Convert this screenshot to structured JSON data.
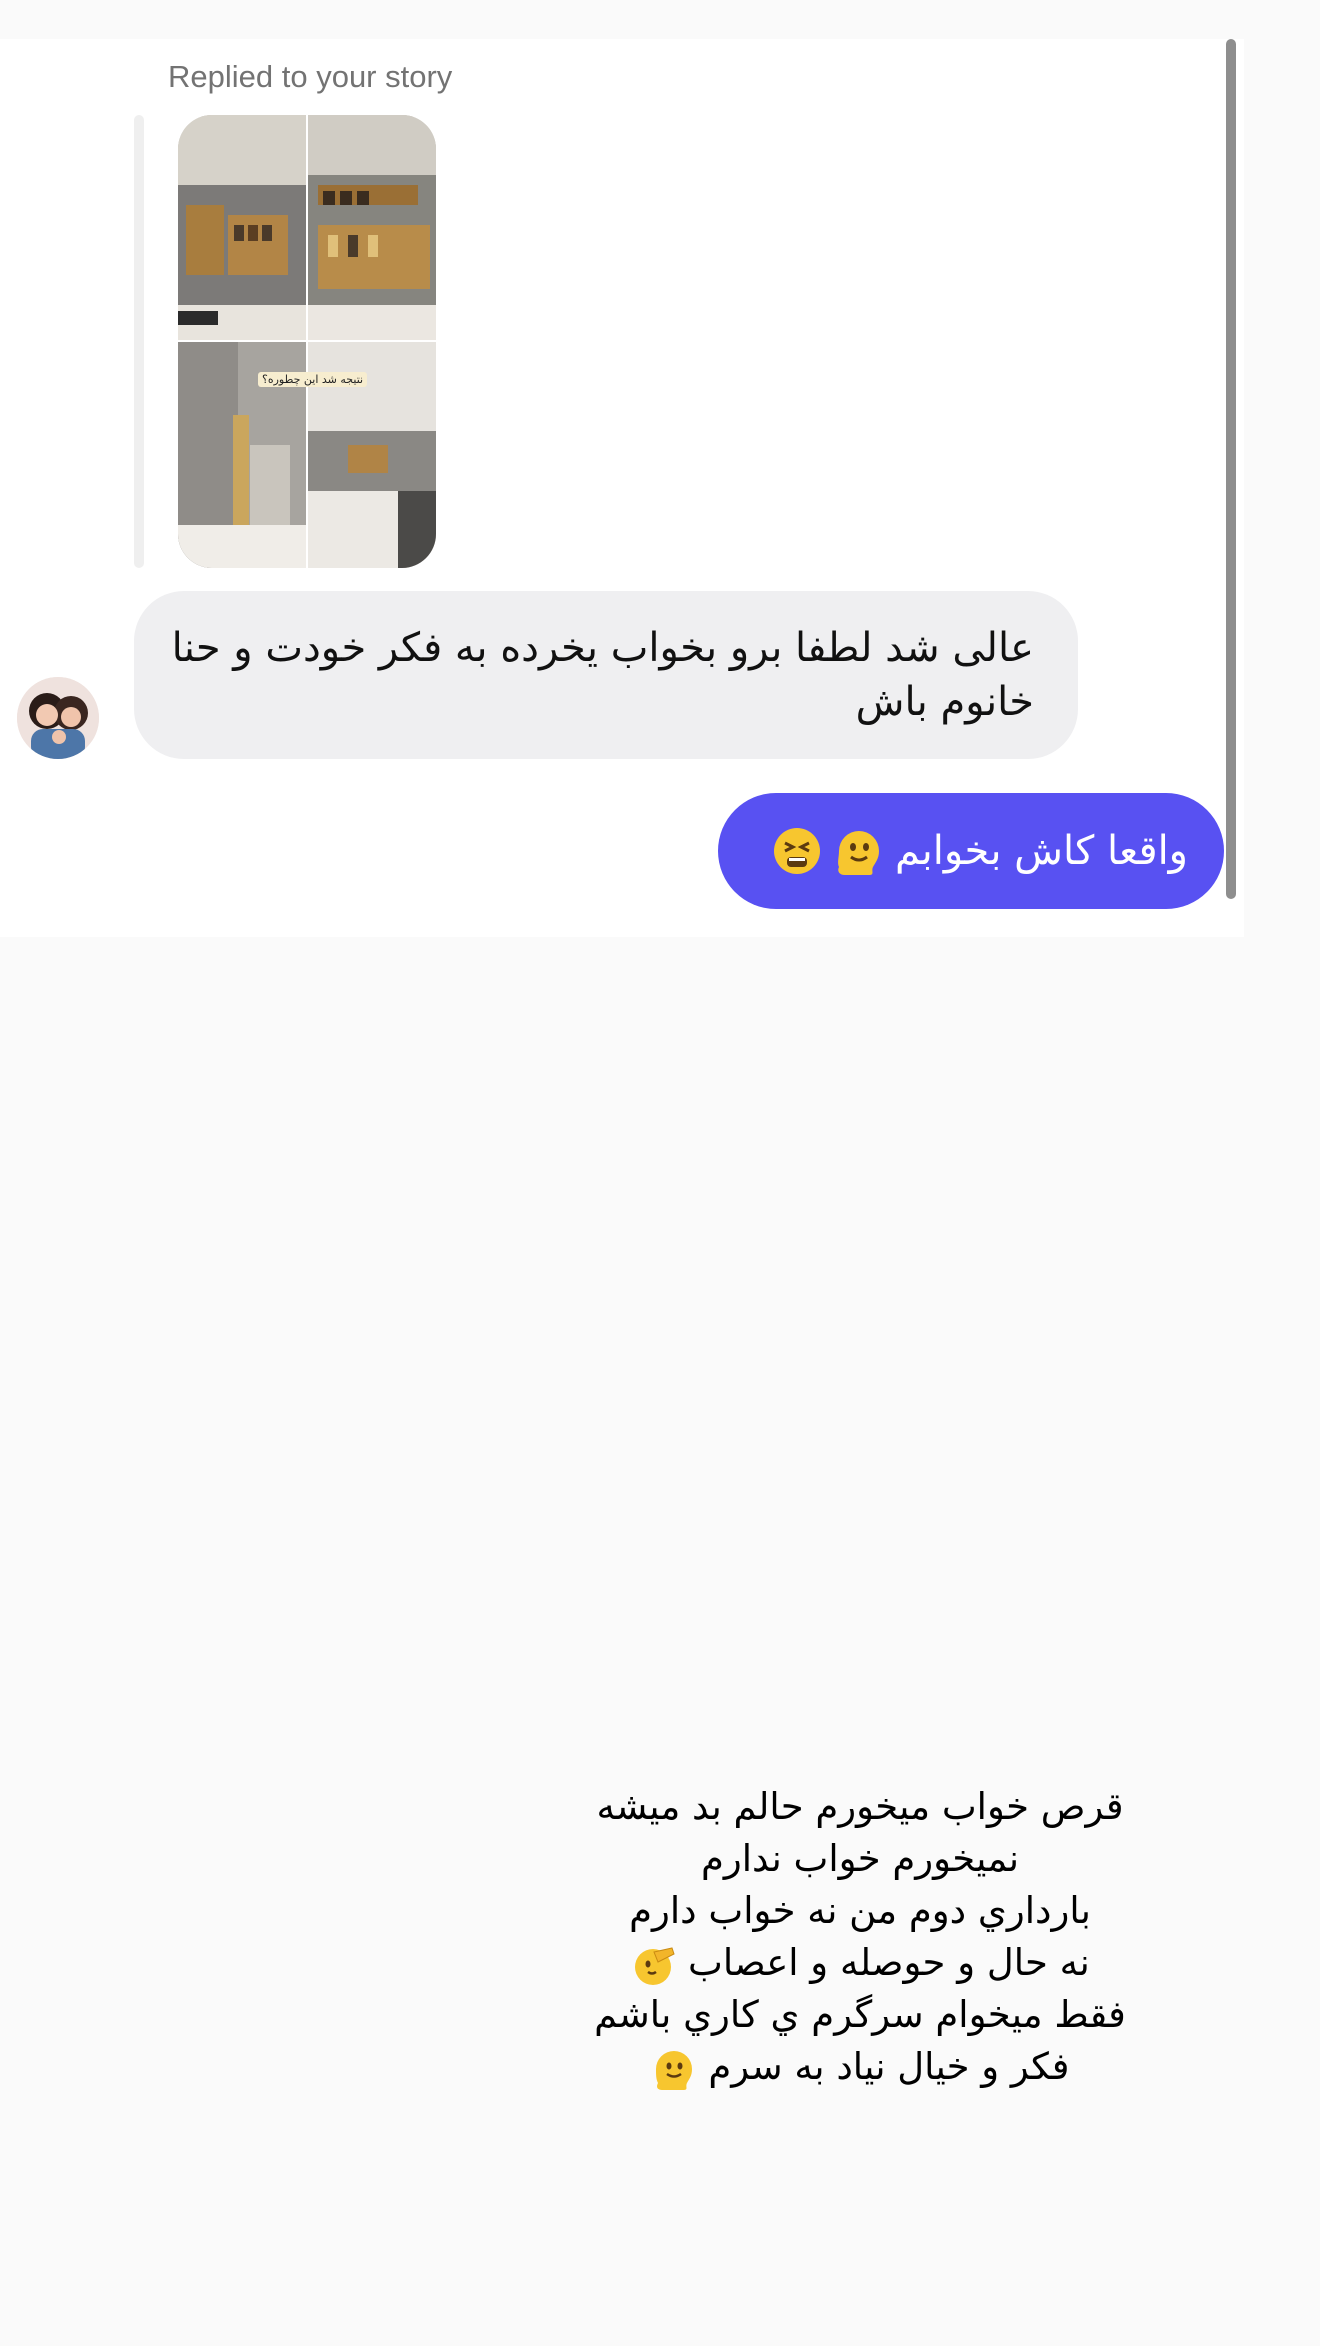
{
  "thread": {
    "reply_label": "Replied to your story",
    "story_caption": "نتيجه شد اين چطوره؟",
    "incoming_message": "عالی شد لطفا برو بخواب یخرده به فکر خودت و حنا خانوم باش",
    "outgoing_message": "واقعا کاش بخوابم",
    "outgoing_emojis": [
      "melting-face",
      "tired-face"
    ]
  },
  "story_text": {
    "lines": [
      "قرص خواب میخورم حالم بد میشه",
      "نمیخورم خواب ندارم",
      "بارداري دوم من نه خواب دارم",
      "نه حال و حوصله و اعصاب",
      "فقط میخوام سرگرم ي کاري باشم",
      "فکر و خیال نیاد به سرم"
    ],
    "line_emojis": {
      "3": "salute-face",
      "5": "melting-face"
    }
  },
  "colors": {
    "outgoing_bubble": "#5851f2",
    "incoming_bubble": "#efeff1",
    "background": "#fafafa"
  }
}
